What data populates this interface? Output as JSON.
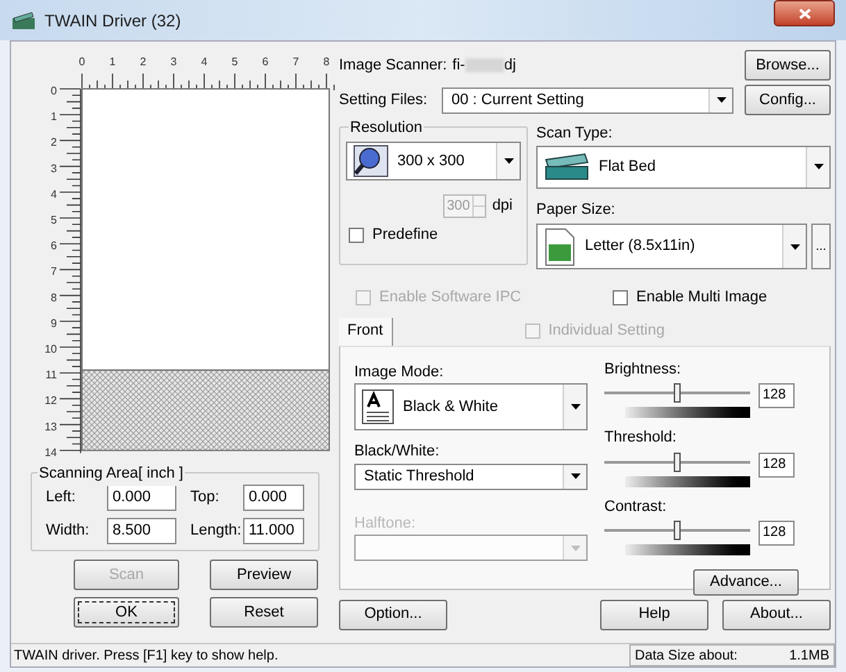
{
  "window": {
    "title": "TWAIN Driver (32)"
  },
  "preview": {
    "x_labels": [
      "0",
      "1",
      "2",
      "3",
      "4",
      "5",
      "6",
      "7",
      "8"
    ],
    "y_labels": [
      "0",
      "1",
      "2",
      "3",
      "4",
      "5",
      "6",
      "7",
      "8",
      "9",
      "10",
      "11",
      "12",
      "13",
      "14"
    ]
  },
  "scanning_area": {
    "title": "Scanning Area[ inch ]",
    "fields": [
      {
        "label": "Left:",
        "value": "0.000"
      },
      {
        "label": "Top:",
        "value": "0.000"
      },
      {
        "label": "Width:",
        "value": "8.500"
      },
      {
        "label": "Length:",
        "value": "11.000"
      }
    ]
  },
  "left_buttons": [
    {
      "label": "Scan",
      "disabled": true,
      "focused": false
    },
    {
      "label": "Preview",
      "disabled": false,
      "focused": false
    },
    {
      "label": "OK",
      "disabled": false,
      "focused": true
    },
    {
      "label": "Reset",
      "disabled": false,
      "focused": false
    }
  ],
  "image_scanner": {
    "label": "Image Scanner:",
    "model_prefix": "fi-",
    "model_suffix": "dj",
    "button": "Browse..."
  },
  "setting_files": {
    "label": "Setting Files:",
    "value": "00 : Current Setting",
    "button": "Config..."
  },
  "resolution": {
    "title": "Resolution",
    "value": "300 x 300",
    "dpi_value": "300",
    "dpi_unit": "dpi",
    "predefine": {
      "label": "Predefine",
      "checked": false
    }
  },
  "scan_type": {
    "label": "Scan Type:",
    "value": "Flat Bed"
  },
  "paper_size": {
    "label": "Paper Size:",
    "value": "Letter (8.5x11in)",
    "more": "..."
  },
  "options": [
    {
      "label": "Enable Software IPC",
      "checked": false,
      "disabled": true
    },
    {
      "label": "Enable Multi Image",
      "checked": false,
      "disabled": false
    }
  ],
  "tabs": [
    {
      "label": "Front",
      "selected": true
    }
  ],
  "individual_setting": {
    "label": "Individual Setting",
    "checked": false,
    "disabled": true
  },
  "image_mode": {
    "label": "Image Mode:",
    "value": "Black & White"
  },
  "black_white": {
    "label": "Black/White:",
    "value": "Static Threshold"
  },
  "halftone": {
    "label": "Halftone:",
    "disabled": true
  },
  "sliders": [
    {
      "label": "Brightness:",
      "level": 0.5,
      "reading": "128"
    },
    {
      "label": "Threshold:",
      "level": 0.5,
      "reading": "128"
    },
    {
      "label": "Contrast:",
      "level": 0.5,
      "reading": "128"
    }
  ],
  "advance_button": "Advance...",
  "bottom_buttons": [
    "Option...",
    "Help",
    "About..."
  ],
  "status_bar": {
    "help": "TWAIN driver. Press [F1] key to show help.",
    "data_size_label": "Data Size about:",
    "data_size": "1.1MB"
  }
}
